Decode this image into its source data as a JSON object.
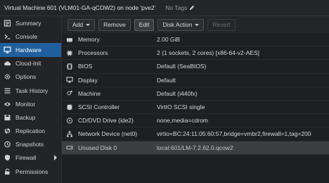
{
  "titlebar": {
    "title": "Virtual Machine 601 (VLM01-GA-qCOW2) on node 'pve2'",
    "tags_label": "No Tags"
  },
  "sidebar": {
    "items": [
      {
        "label": "Summary",
        "icon": "summary-icon"
      },
      {
        "label": "Console",
        "icon": "console-icon"
      },
      {
        "label": "Hardware",
        "icon": "hardware-icon"
      },
      {
        "label": "Cloud-Init",
        "icon": "cloud-icon"
      },
      {
        "label": "Options",
        "icon": "gear-icon"
      },
      {
        "label": "Task History",
        "icon": "list-icon"
      },
      {
        "label": "Monitor",
        "icon": "eye-icon"
      },
      {
        "label": "Backup",
        "icon": "floppy-icon"
      },
      {
        "label": "Replication",
        "icon": "retweet-icon"
      },
      {
        "label": "Snapshots",
        "icon": "history-icon"
      },
      {
        "label": "Firewall",
        "icon": "shield-icon"
      },
      {
        "label": "Permissions",
        "icon": "unlock-icon"
      }
    ],
    "active_index": 2
  },
  "toolbar": {
    "add_label": "Add",
    "remove_label": "Remove",
    "edit_label": "Edit",
    "disk_action_label": "Disk Action",
    "revert_label": "Revert"
  },
  "hardware": {
    "rows": [
      {
        "key": "Memory",
        "value": "2.00 GiB",
        "icon": "memory-icon"
      },
      {
        "key": "Processors",
        "value": "2 (1 sockets, 2 cores) [x86-64-v2-AES]",
        "icon": "cpu-icon"
      },
      {
        "key": "BIOS",
        "value": "Default (SeaBIOS)",
        "icon": "chip-icon"
      },
      {
        "key": "Display",
        "value": "Default",
        "icon": "desktop-icon"
      },
      {
        "key": "Machine",
        "value": "Default (i440fx)",
        "icon": "cogs-icon"
      },
      {
        "key": "SCSI Controller",
        "value": "VirtIO SCSI single",
        "icon": "database-icon"
      },
      {
        "key": "CD/DVD Drive (ide2)",
        "value": "none,media=cdrom",
        "icon": "cdrom-icon"
      },
      {
        "key": "Network Device (net0)",
        "value": "virtio=BC:24:11:05:60:57,bridge=vmbr2,firewall=1,tag=200",
        "icon": "network-icon"
      },
      {
        "key": "Unused Disk 0",
        "value": "local:601/LM-7.2.62.0.qcow2",
        "icon": "hdd-icon"
      }
    ],
    "selected_index": 8
  }
}
